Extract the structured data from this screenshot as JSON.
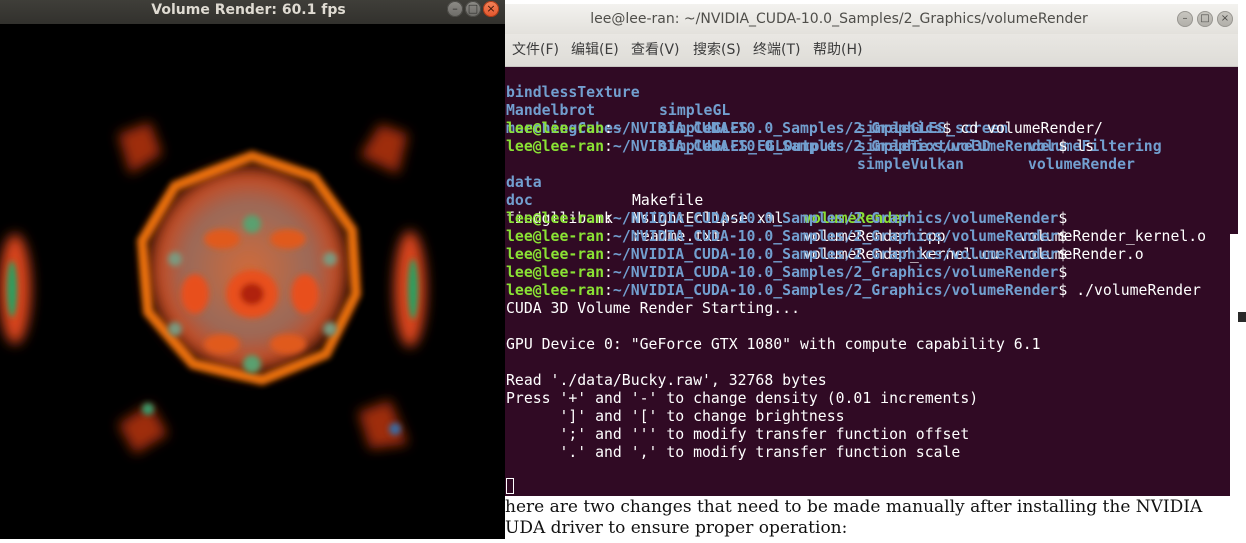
{
  "volume_window": {
    "title": "Volume Render: 60.1 fps",
    "buttons": {
      "minimize": "–",
      "maximize": "□",
      "close": "×"
    }
  },
  "terminal": {
    "title": "lee@lee-ran: ~/NVIDIA_CUDA-10.0_Samples/2_Graphics/volumeRender",
    "buttons": {
      "minimize": "–",
      "maximize": "□",
      "close": "×"
    },
    "menu": [
      "文件(F)",
      "编辑(E)",
      "查看(V)",
      "搜索(S)",
      "终端(T)",
      "帮助(H)"
    ],
    "top_listing": [
      [
        "bindlessTexture",
        "simpleGL",
        "simpleGLES_screen",
        "volumeFiltering"
      ],
      [
        "Mandelbrot",
        "simpleGLES",
        "simpleTexture3D",
        "volumeRender"
      ],
      [
        "marchingCubes",
        "simpleGLES_EGLOutput",
        "simpleVulkan",
        ""
      ]
    ],
    "prompt_user": "lee@lee-ran",
    "path_graphics": "~/NVIDIA_CUDA-10.0_Samples/2_Graphics",
    "path_volume": "~/NVIDIA_CUDA-10.0_Samples/2_Graphics/volumeRender",
    "cmd_cd": " cd volumeRender/",
    "cmd_ls": " ls",
    "cmd_run": " ./volumeRender",
    "ls_listing": [
      [
        "data",
        "Makefile",
        "volumeRender",
        "volumeRender_kernel.o"
      ],
      [
        "doc",
        "NsightEclipse.xml",
        "volumeRender.cpp",
        "volumeRender.o"
      ],
      [
        "findgllib.mk",
        "readme.txt",
        "volumeRender_kernel.cu",
        ""
      ]
    ],
    "output": [
      "CUDA 3D Volume Render Starting...",
      "",
      "GPU Device 0: \"GeForce GTX 1080\" with compute capability 6.1",
      "",
      "Read './data/Bucky.raw', 32768 bytes",
      "Press '+' and '-' to change density (0.01 increments)",
      "      ']' and '[' to change brightness",
      "      ';' and ''' to modify transfer function offset",
      "      '.' and ',' to modify transfer function scale"
    ]
  },
  "document": {
    "line1": "here are two changes that need to be made manually after installing the NVIDIA",
    "line2": "UDA driver to ensure proper operation:"
  },
  "colors": {
    "terminal_bg": "#300a24",
    "prompt_green": "#8ae234",
    "path_blue": "#729fcf"
  }
}
